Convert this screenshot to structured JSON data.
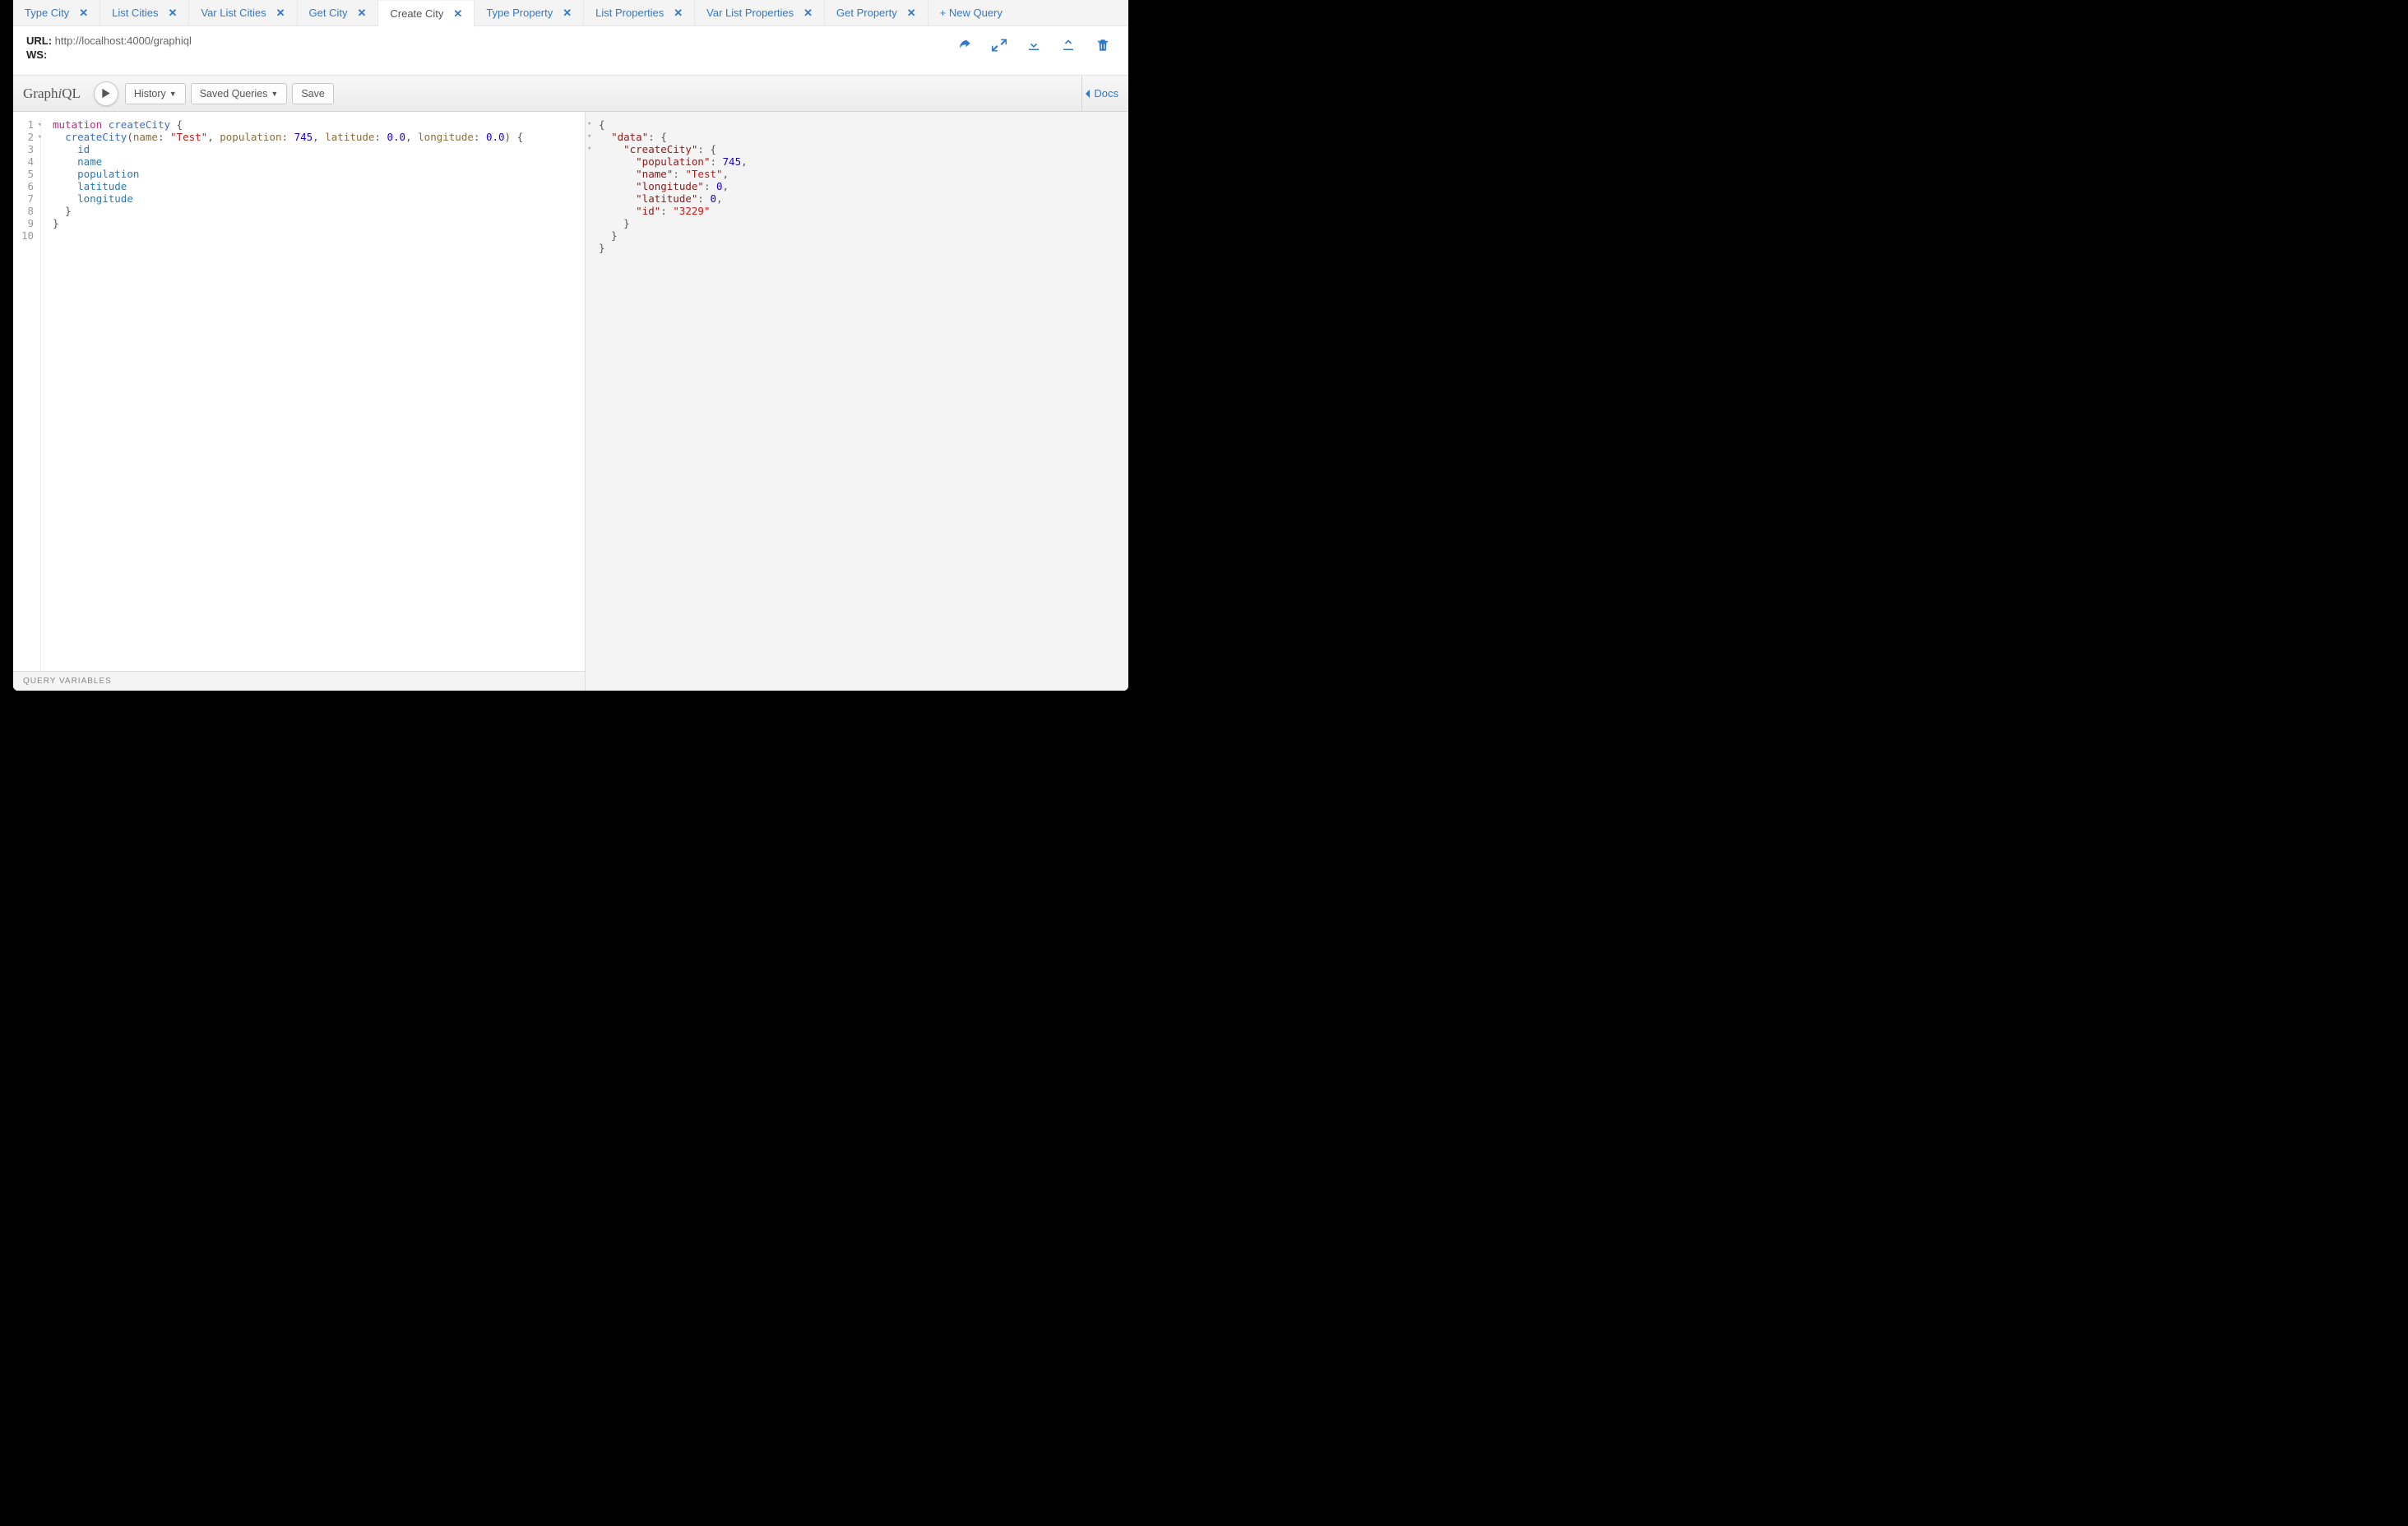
{
  "tabs": [
    {
      "label": "Type City",
      "active": false
    },
    {
      "label": "List Cities",
      "active": false
    },
    {
      "label": "Var List Cities",
      "active": false
    },
    {
      "label": "Get City",
      "active": false
    },
    {
      "label": "Create City",
      "active": true
    },
    {
      "label": "Type Property",
      "active": false
    },
    {
      "label": "List Properties",
      "active": false
    },
    {
      "label": "Var List Properties",
      "active": false
    },
    {
      "label": "Get Property",
      "active": false
    }
  ],
  "new_query_label": "+ New Query",
  "url_label": "URL:",
  "url_value": "http://localhost:4000/graphiql",
  "ws_label": "WS:",
  "ws_value": "",
  "toolbar": {
    "logo_pre": "Graph",
    "logo_i": "i",
    "logo_post": "QL",
    "history": "History",
    "saved": "Saved Queries",
    "save": "Save",
    "docs": "Docs"
  },
  "query_lines": {
    "l1": {
      "kw": "mutation",
      "op": "createCity",
      "open": "{"
    },
    "l2": {
      "fn": "createCity",
      "args": [
        {
          "name": "name",
          "type": "str",
          "value": "\"Test\""
        },
        {
          "name": "population",
          "type": "num",
          "value": "745"
        },
        {
          "name": "latitude",
          "type": "num",
          "value": "0.0"
        },
        {
          "name": "longitude",
          "type": "num",
          "value": "0.0"
        }
      ],
      "open": "{"
    },
    "l3": "id",
    "l4": "name",
    "l5": "population",
    "l6": "latitude",
    "l7": "longitude",
    "l8": "}",
    "l9": "}",
    "l10": ""
  },
  "line_numbers": [
    "1",
    "2",
    "3",
    "4",
    "5",
    "6",
    "7",
    "8",
    "9",
    "10"
  ],
  "qv_label": "Query Variables",
  "result": {
    "data_key": "\"data\"",
    "createCity_key": "\"createCity\"",
    "rows": [
      {
        "k": "\"population\"",
        "v": "745",
        "t": "num",
        "comma": ","
      },
      {
        "k": "\"name\"",
        "v": "\"Test\"",
        "t": "str",
        "comma": ","
      },
      {
        "k": "\"longitude\"",
        "v": "0",
        "t": "num",
        "comma": ","
      },
      {
        "k": "\"latitude\"",
        "v": "0",
        "t": "num",
        "comma": ","
      },
      {
        "k": "\"id\"",
        "v": "\"3229\"",
        "t": "str",
        "comma": ""
      }
    ]
  }
}
